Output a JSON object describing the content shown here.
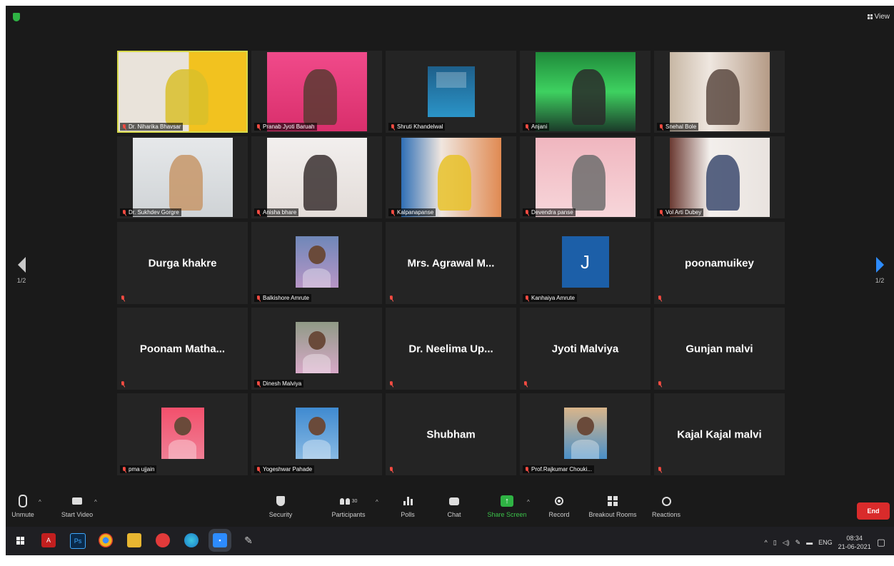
{
  "top": {
    "view_label": "View"
  },
  "pager": {
    "left_label": "1/2",
    "right_label": "1/2"
  },
  "tiles": [
    {
      "name": "Dr. Niharika Bhavsar",
      "kind": "video",
      "bg": "linear-gradient(90deg,#e9e3da 0 55%,#f2c21f 55% 100%)",
      "fg": "#d9c02a",
      "active": true
    },
    {
      "name": "Pranab Jyoti Baruah",
      "kind": "video",
      "bg": "linear-gradient(180deg,#f04a8a,#d92f6c)",
      "fg": "#5a3a33"
    },
    {
      "name": "Shruti Khandelwal",
      "kind": "book",
      "bg": "linear-gradient(180deg,#1e5f8a,#2b94c8)"
    },
    {
      "name": "Anjani",
      "kind": "video",
      "bg": "linear-gradient(180deg,#1f8a3a,#3ed160 50%,#1b3b2a)",
      "fg": "#2a2a2a"
    },
    {
      "name": "Snehal Bole",
      "kind": "video",
      "bg": "linear-gradient(90deg,#c7b7a4,#efe7e0 40%,#b59b86)",
      "fg": "#5c4a42"
    },
    {
      "name": "Dr. Sukhdev Gorgre",
      "kind": "video",
      "bg": "linear-gradient(180deg,#e6e8ea,#cfd3d6)",
      "fg": "#c79668"
    },
    {
      "name": "Anisha bhare",
      "kind": "video",
      "bg": "linear-gradient(180deg,#f2efee,#e3dcd8)",
      "fg": "#3a3030"
    },
    {
      "name": "Kalpanapanse",
      "kind": "video",
      "bg": "linear-gradient(90deg,#2f6fb6,#f0e6df 40%,#e08a52)",
      "fg": "#e7c22a"
    },
    {
      "name": "Devendra panse",
      "kind": "video",
      "bg": "linear-gradient(180deg,#f0b6bf,#f7d6da)",
      "fg": "#6d6d6d"
    },
    {
      "name": "Vol Arti Dubey",
      "kind": "video",
      "bg": "linear-gradient(90deg,#6b3a32,#f3efec 40%,#e9e3df)",
      "fg": "#3c4a6e"
    },
    {
      "name": "Durga khakre",
      "kind": "text"
    },
    {
      "name": "Balkishore Amrute",
      "kind": "avatar",
      "bg": "linear-gradient(180deg,#6f87b8,#b896c6)"
    },
    {
      "name": "Mrs. Agrawal M...",
      "kind": "text"
    },
    {
      "name": "Kanhaiya Amrute",
      "kind": "initial",
      "initial": "J"
    },
    {
      "name": "poonamuikey",
      "kind": "text"
    },
    {
      "name": "Poonam Matha...",
      "kind": "text"
    },
    {
      "name": "Dinesh Malviya",
      "kind": "avatar",
      "bg": "linear-gradient(180deg,#8f9a86,#d7a9c8)"
    },
    {
      "name": "Dr. Neelima Up...",
      "kind": "text"
    },
    {
      "name": "Jyoti Malviya",
      "kind": "text"
    },
    {
      "name": "Gunjan malvi",
      "kind": "text"
    },
    {
      "name": "pma ujjain",
      "kind": "avatar",
      "bg": "linear-gradient(180deg,#f2506c,#f07f95)"
    },
    {
      "name": "Yogeshwar Pahade",
      "kind": "avatar",
      "bg": "linear-gradient(180deg,#3f8ad0,#88b9e3)"
    },
    {
      "name": "Shubham",
      "kind": "text"
    },
    {
      "name": "Prof.Rajkumar Chouki...",
      "kind": "avatar",
      "bg": "linear-gradient(180deg,#d9b58a,#4a90c8)"
    },
    {
      "name": "Kajal Kajal malvi",
      "kind": "text"
    }
  ],
  "toolbar": {
    "unmute": "Unmute",
    "start_video": "Start Video",
    "security": "Security",
    "participants": "Participants",
    "participants_count": "30",
    "polls": "Polls",
    "chat": "Chat",
    "share_screen": "Share Screen",
    "record": "Record",
    "breakout_rooms": "Breakout Rooms",
    "reactions": "Reactions",
    "end": "End"
  },
  "taskbar": {
    "lang": "ENG",
    "time": "08:34",
    "date": "21-06-2021"
  },
  "colors": {
    "accent_blue": "#2d8cff",
    "share_green": "#2fb344",
    "end_red": "#d92b2b",
    "muted_red": "#e8433a"
  }
}
